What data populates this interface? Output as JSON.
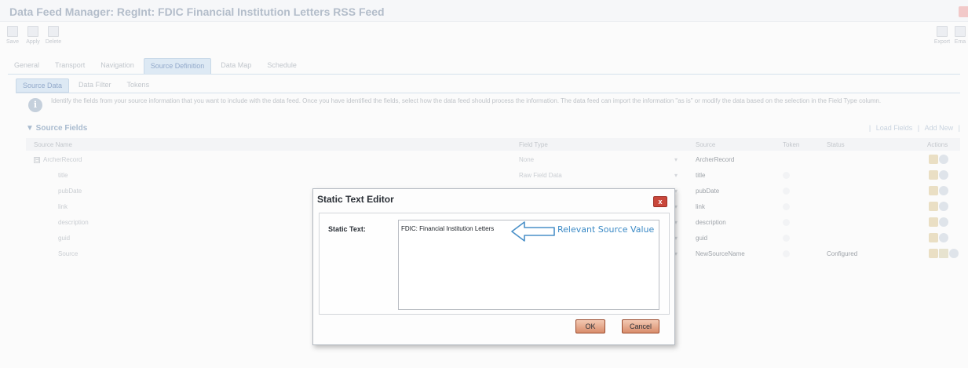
{
  "window": {
    "title": "Data Feed Manager: RegInt: FDIC Financial Institution Letters RSS Feed"
  },
  "toolbar": {
    "save": "Save",
    "apply": "Apply",
    "delete": "Delete",
    "export": "Export",
    "email": "Ema"
  },
  "tabs": [
    "General",
    "Transport",
    "Navigation",
    "Source Definition",
    "Data Map",
    "Schedule"
  ],
  "active_tab": "Source Definition",
  "subtabs": [
    "Source Data",
    "Data Filter",
    "Tokens"
  ],
  "active_subtab": "Source Data",
  "info": {
    "text": "Identify the fields from your source information that you want to include with the data feed. Once you have identified the fields, select how the data feed should process the information. The data feed can import the information \"as is\" or modify the data based on the selection in the Field Type column."
  },
  "section": {
    "title": "▼ Source Fields",
    "load_fields": "Load Fields",
    "add_new": "Add New",
    "separator": "|"
  },
  "columns": {
    "source_name": "Source Name",
    "field_type": "Field Type",
    "source": "Source",
    "token": "Token",
    "status": "Status",
    "actions": "Actions"
  },
  "rows": [
    {
      "name": "ArcherRecord",
      "field_type": "None",
      "source": "ArcherRecord",
      "status": "",
      "expander": "⊟"
    },
    {
      "name": "title",
      "field_type": "Raw Field Data",
      "source": "title",
      "status": ""
    },
    {
      "name": "pubDate",
      "field_type": "",
      "source": "pubDate",
      "status": ""
    },
    {
      "name": "link",
      "field_type": "",
      "source": "link",
      "status": ""
    },
    {
      "name": "description",
      "field_type": "",
      "source": "description",
      "status": ""
    },
    {
      "name": "guid",
      "field_type": "",
      "source": "guid",
      "status": ""
    },
    {
      "name": "Source",
      "field_type": "",
      "source": "NewSourceName",
      "status": "Configured"
    }
  ],
  "dialog": {
    "title": "Static Text Editor",
    "close_label": "x",
    "field_label": "Static Text:",
    "field_value": "FDIC: Financial Institution Letters",
    "ok_label": "OK",
    "cancel_label": "Cancel"
  },
  "annotation": {
    "text": "Relevant Source Value",
    "color": "#3b8ac6"
  },
  "colors": {
    "dialog_close": "#c9473b",
    "button_fill": "#d98d6c",
    "active_tab": "#dde9f4"
  }
}
